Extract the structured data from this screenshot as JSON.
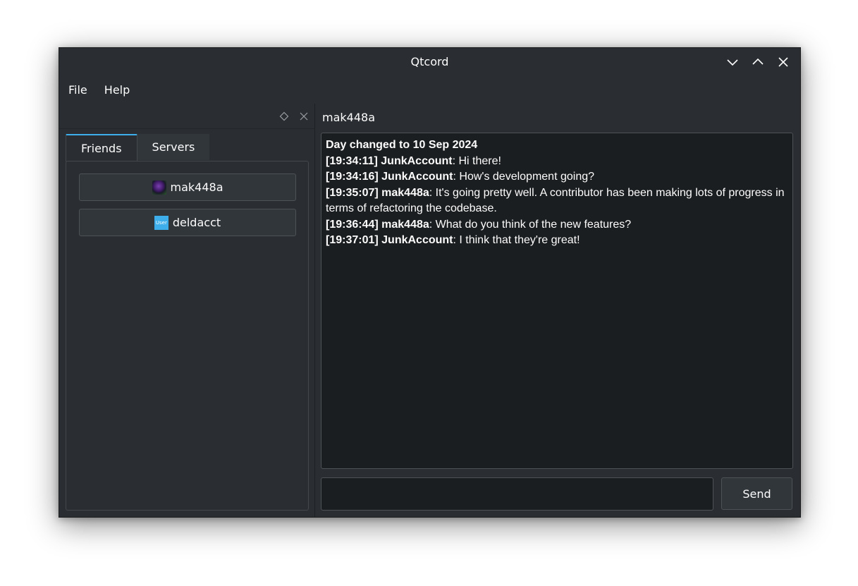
{
  "window": {
    "title": "Qtcord"
  },
  "menu": [
    {
      "label": "File"
    },
    {
      "label": "Help"
    }
  ],
  "tabs": [
    {
      "label": "Friends"
    },
    {
      "label": "Servers"
    }
  ],
  "friends": [
    {
      "name": "mak448a",
      "avatar": "avatar-image"
    },
    {
      "name": "deldacct",
      "avatar_text": "User"
    }
  ],
  "chat": {
    "title": "mak448a",
    "messages": [
      {
        "bold": "Day changed to 10 Sep 2024",
        "text": ""
      },
      {
        "bold": "[19:34:11] JunkAccount",
        "text": ": Hi there!"
      },
      {
        "bold": "[19:34:16] JunkAccount",
        "text": ": How's development going?"
      },
      {
        "bold": "[19:35:07] mak448a",
        "text": ": It's going pretty well. A contributor has been making lots of progress in terms of refactoring the codebase."
      },
      {
        "bold": "[19:36:44] mak448a",
        "text": ": What do you think of the new features?"
      },
      {
        "bold": "[19:37:01] JunkAccount",
        "text": ": I think that they're great!"
      }
    ],
    "input_value": "",
    "send_label": "Send"
  },
  "colors": {
    "accent": "#3daee9",
    "background": "#2a2e32",
    "chat_background": "#1b1e20"
  }
}
